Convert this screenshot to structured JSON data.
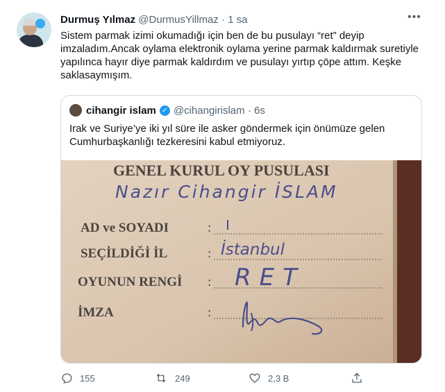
{
  "tweet": {
    "author_name": "Durmuş Yılmaz",
    "author_handle": "@DurmusYillmaz",
    "separator": "·",
    "time": "1 sa",
    "text": "Sistem parmak izimi okumadığı için ben de bu pusulayı “ret” deyip imzaladım.Ancak oylama elektronik oylama yerine parmak kaldırmak suretiyle yapılınca hayır diye parmak kaldırdım ve pusulayı yırtıp çöpe attım. Keşke saklasaymışım.",
    "more_icon": "more-icon"
  },
  "quoted": {
    "author_name": "cihangir islam",
    "author_handle": "@cihangirislam",
    "separator": "·",
    "time": "6s",
    "text": "Irak ve Suriye’ye iki yıl süre ile asker göndermek için önümüze gelen Cumhurbaşkanlığı tezkeresini kabul etmiyoruz.",
    "ballot": {
      "heading": "GENEL KURUL OY PUSULASI",
      "handwritten_name": "Nazır Cihangir İSLAM",
      "fields": [
        {
          "label": "AD ve SOYADI",
          "value": ""
        },
        {
          "label": "SEÇİLDİĞİ İL",
          "value": "İstanbul"
        },
        {
          "label": "OYUNUN RENGİ",
          "value": "RET"
        },
        {
          "label": "İMZA",
          "value": ""
        }
      ]
    }
  },
  "actions": {
    "replies": "155",
    "retweets": "249",
    "likes": "2,3 B"
  },
  "colors": {
    "paper": "#d9c4ad",
    "ink": "#4a4e8c",
    "verified": "#1d9bf0",
    "muted": "#536471"
  }
}
